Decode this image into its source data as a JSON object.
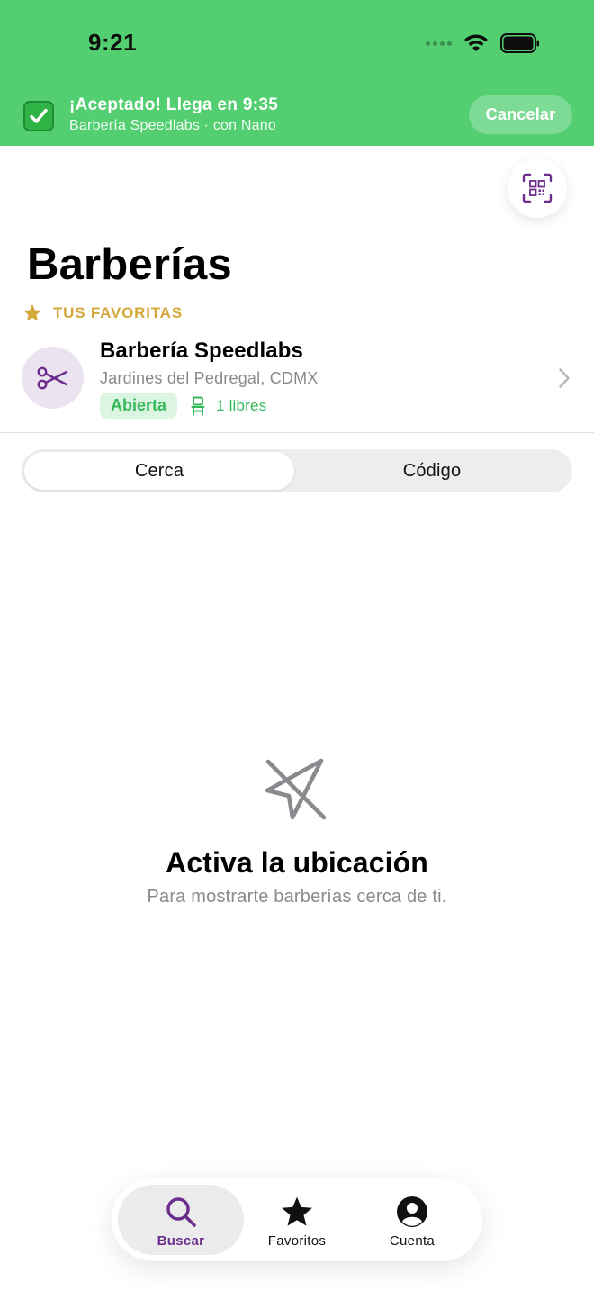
{
  "status_bar": {
    "time": "9:21"
  },
  "banner": {
    "emoji_icon": "check-mark-button-icon",
    "title": "¡Aceptado! Llega en 9:35",
    "subtitle": "Barbería Speedlabs · con Nano",
    "cancel_label": "Cancelar",
    "background_color": "#53cf72"
  },
  "header": {
    "title": "Barberías",
    "qr_icon": "qr-scan-icon"
  },
  "favorites": {
    "section_label": "TUS FAVORITAS",
    "items": [
      {
        "name": "Barbería Speedlabs",
        "address": "Jardines del Pedregal, CDMX",
        "status": "Abierta",
        "seats": "1 libres",
        "icon": "scissors-icon"
      }
    ]
  },
  "segmented": {
    "options": [
      "Cerca",
      "Código"
    ],
    "selected": "Cerca"
  },
  "empty_state": {
    "icon": "location-slash-icon",
    "title": "Activa la ubicación",
    "subtitle": "Para mostrarte barberías cerca de ti."
  },
  "tabbar": {
    "tabs": [
      {
        "label": "Buscar",
        "icon": "search-icon",
        "active": true
      },
      {
        "label": "Favoritos",
        "icon": "star-icon",
        "active": false
      },
      {
        "label": "Cuenta",
        "icon": "person-circle-icon",
        "active": false
      }
    ]
  },
  "colors": {
    "accent": "#6a2d8c",
    "success": "#33b85a",
    "gold": "#d4a93a"
  }
}
